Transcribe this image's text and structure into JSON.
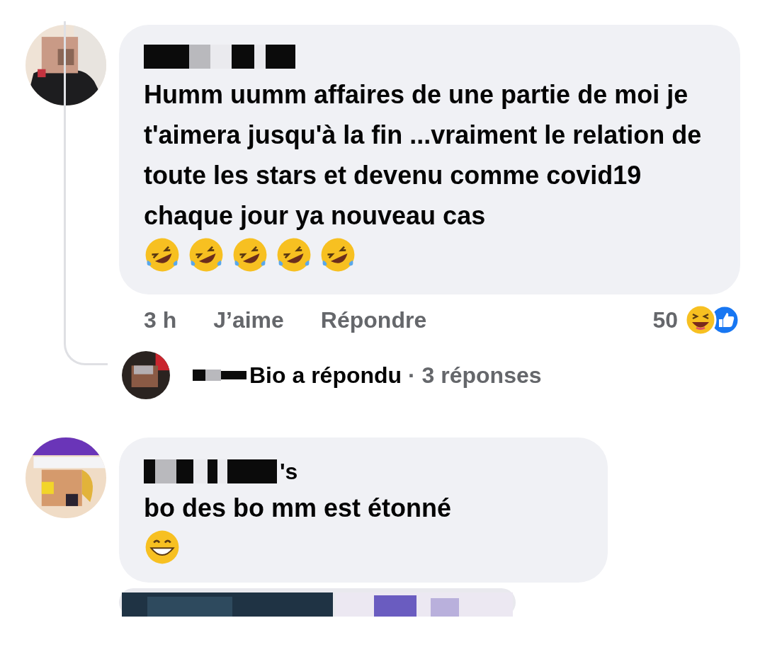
{
  "comments": [
    {
      "text": "Humm uumm affaires de une partie de moi je t'aimera jusqu'à la fin ...vraiment le relation de toute les stars et devenu comme covid19 chaque jour ya nouveau cas",
      "emojis": [
        {
          "kind": "rofl"
        },
        {
          "kind": "rofl"
        },
        {
          "kind": "rofl"
        },
        {
          "kind": "rofl"
        },
        {
          "kind": "rofl"
        }
      ],
      "time": "3 h",
      "actions": [
        "J’aime",
        "Répondre"
      ],
      "reaction_count": "50",
      "reply": {
        "name": "Bio",
        "action": "a répondu",
        "count": "· 3 réponses"
      }
    },
    {
      "text": "bo des bo mm est étonné",
      "name_suffix": "'s",
      "emojis": [
        {
          "kind": "grin"
        }
      ]
    }
  ]
}
